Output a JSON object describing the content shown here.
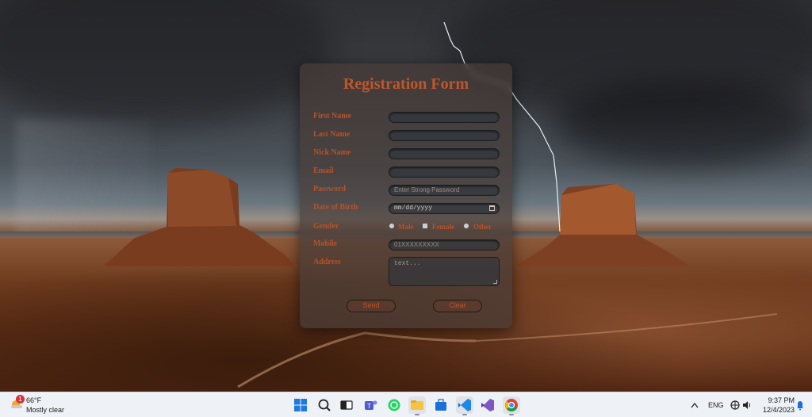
{
  "form": {
    "title": "Registration Form",
    "fields": {
      "first_name": {
        "label": "First Name",
        "placeholder": ""
      },
      "last_name": {
        "label": "Last Name",
        "placeholder": ""
      },
      "nick_name": {
        "label": "Nick Name",
        "placeholder": ""
      },
      "email": {
        "label": "Email",
        "placeholder": ""
      },
      "password": {
        "label": "Password",
        "placeholder": "Enter Strong Password"
      },
      "dob": {
        "label": "Date of Birth",
        "value": "mm/dd/yyyy"
      },
      "gender": {
        "label": "Gender",
        "options": [
          "Male",
          "Female",
          "Other"
        ]
      },
      "mobile": {
        "label": "Mobile",
        "placeholder": "01XXXXXXXXX"
      },
      "address": {
        "label": "Address",
        "placeholder": "text..."
      }
    },
    "buttons": {
      "send": "Send",
      "clear": "Clear"
    }
  },
  "taskbar": {
    "weather": {
      "badge": "1",
      "temp": "66°F",
      "desc": "Mostly clear"
    },
    "language": "ENG",
    "time": "9:37 PM",
    "date": "12/4/2023",
    "icons": [
      "windows-start",
      "search",
      "task-view",
      "teams",
      "whatsapp",
      "file-explorer",
      "microsoft-store",
      "vscode",
      "visual-studio",
      "chrome"
    ]
  }
}
